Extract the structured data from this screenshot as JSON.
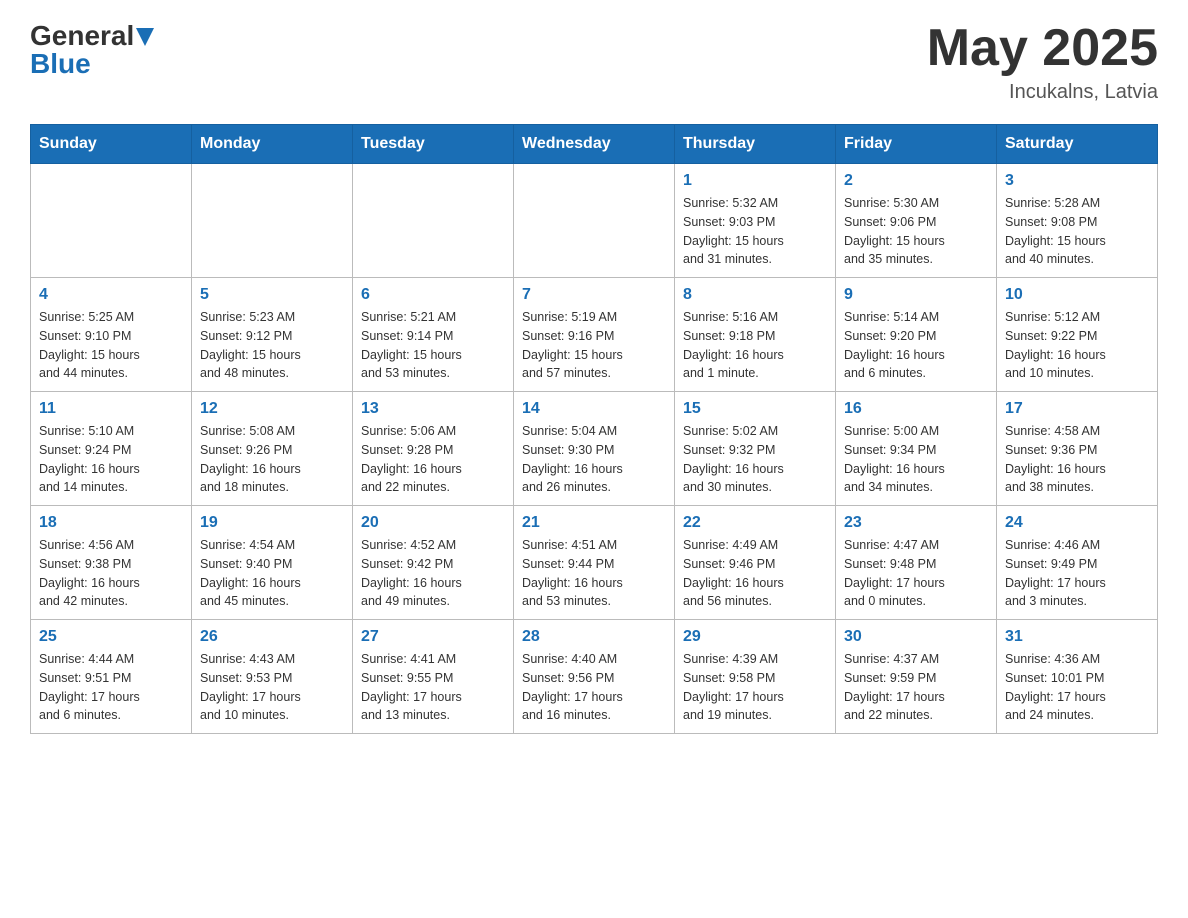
{
  "header": {
    "logo_general": "General",
    "logo_blue": "Blue",
    "month_year": "May 2025",
    "location": "Incukalns, Latvia"
  },
  "weekdays": [
    "Sunday",
    "Monday",
    "Tuesday",
    "Wednesday",
    "Thursday",
    "Friday",
    "Saturday"
  ],
  "weeks": [
    [
      {
        "day": "",
        "info": ""
      },
      {
        "day": "",
        "info": ""
      },
      {
        "day": "",
        "info": ""
      },
      {
        "day": "",
        "info": ""
      },
      {
        "day": "1",
        "info": "Sunrise: 5:32 AM\nSunset: 9:03 PM\nDaylight: 15 hours\nand 31 minutes."
      },
      {
        "day": "2",
        "info": "Sunrise: 5:30 AM\nSunset: 9:06 PM\nDaylight: 15 hours\nand 35 minutes."
      },
      {
        "day": "3",
        "info": "Sunrise: 5:28 AM\nSunset: 9:08 PM\nDaylight: 15 hours\nand 40 minutes."
      }
    ],
    [
      {
        "day": "4",
        "info": "Sunrise: 5:25 AM\nSunset: 9:10 PM\nDaylight: 15 hours\nand 44 minutes."
      },
      {
        "day": "5",
        "info": "Sunrise: 5:23 AM\nSunset: 9:12 PM\nDaylight: 15 hours\nand 48 minutes."
      },
      {
        "day": "6",
        "info": "Sunrise: 5:21 AM\nSunset: 9:14 PM\nDaylight: 15 hours\nand 53 minutes."
      },
      {
        "day": "7",
        "info": "Sunrise: 5:19 AM\nSunset: 9:16 PM\nDaylight: 15 hours\nand 57 minutes."
      },
      {
        "day": "8",
        "info": "Sunrise: 5:16 AM\nSunset: 9:18 PM\nDaylight: 16 hours\nand 1 minute."
      },
      {
        "day": "9",
        "info": "Sunrise: 5:14 AM\nSunset: 9:20 PM\nDaylight: 16 hours\nand 6 minutes."
      },
      {
        "day": "10",
        "info": "Sunrise: 5:12 AM\nSunset: 9:22 PM\nDaylight: 16 hours\nand 10 minutes."
      }
    ],
    [
      {
        "day": "11",
        "info": "Sunrise: 5:10 AM\nSunset: 9:24 PM\nDaylight: 16 hours\nand 14 minutes."
      },
      {
        "day": "12",
        "info": "Sunrise: 5:08 AM\nSunset: 9:26 PM\nDaylight: 16 hours\nand 18 minutes."
      },
      {
        "day": "13",
        "info": "Sunrise: 5:06 AM\nSunset: 9:28 PM\nDaylight: 16 hours\nand 22 minutes."
      },
      {
        "day": "14",
        "info": "Sunrise: 5:04 AM\nSunset: 9:30 PM\nDaylight: 16 hours\nand 26 minutes."
      },
      {
        "day": "15",
        "info": "Sunrise: 5:02 AM\nSunset: 9:32 PM\nDaylight: 16 hours\nand 30 minutes."
      },
      {
        "day": "16",
        "info": "Sunrise: 5:00 AM\nSunset: 9:34 PM\nDaylight: 16 hours\nand 34 minutes."
      },
      {
        "day": "17",
        "info": "Sunrise: 4:58 AM\nSunset: 9:36 PM\nDaylight: 16 hours\nand 38 minutes."
      }
    ],
    [
      {
        "day": "18",
        "info": "Sunrise: 4:56 AM\nSunset: 9:38 PM\nDaylight: 16 hours\nand 42 minutes."
      },
      {
        "day": "19",
        "info": "Sunrise: 4:54 AM\nSunset: 9:40 PM\nDaylight: 16 hours\nand 45 minutes."
      },
      {
        "day": "20",
        "info": "Sunrise: 4:52 AM\nSunset: 9:42 PM\nDaylight: 16 hours\nand 49 minutes."
      },
      {
        "day": "21",
        "info": "Sunrise: 4:51 AM\nSunset: 9:44 PM\nDaylight: 16 hours\nand 53 minutes."
      },
      {
        "day": "22",
        "info": "Sunrise: 4:49 AM\nSunset: 9:46 PM\nDaylight: 16 hours\nand 56 minutes."
      },
      {
        "day": "23",
        "info": "Sunrise: 4:47 AM\nSunset: 9:48 PM\nDaylight: 17 hours\nand 0 minutes."
      },
      {
        "day": "24",
        "info": "Sunrise: 4:46 AM\nSunset: 9:49 PM\nDaylight: 17 hours\nand 3 minutes."
      }
    ],
    [
      {
        "day": "25",
        "info": "Sunrise: 4:44 AM\nSunset: 9:51 PM\nDaylight: 17 hours\nand 6 minutes."
      },
      {
        "day": "26",
        "info": "Sunrise: 4:43 AM\nSunset: 9:53 PM\nDaylight: 17 hours\nand 10 minutes."
      },
      {
        "day": "27",
        "info": "Sunrise: 4:41 AM\nSunset: 9:55 PM\nDaylight: 17 hours\nand 13 minutes."
      },
      {
        "day": "28",
        "info": "Sunrise: 4:40 AM\nSunset: 9:56 PM\nDaylight: 17 hours\nand 16 minutes."
      },
      {
        "day": "29",
        "info": "Sunrise: 4:39 AM\nSunset: 9:58 PM\nDaylight: 17 hours\nand 19 minutes."
      },
      {
        "day": "30",
        "info": "Sunrise: 4:37 AM\nSunset: 9:59 PM\nDaylight: 17 hours\nand 22 minutes."
      },
      {
        "day": "31",
        "info": "Sunrise: 4:36 AM\nSunset: 10:01 PM\nDaylight: 17 hours\nand 24 minutes."
      }
    ]
  ]
}
